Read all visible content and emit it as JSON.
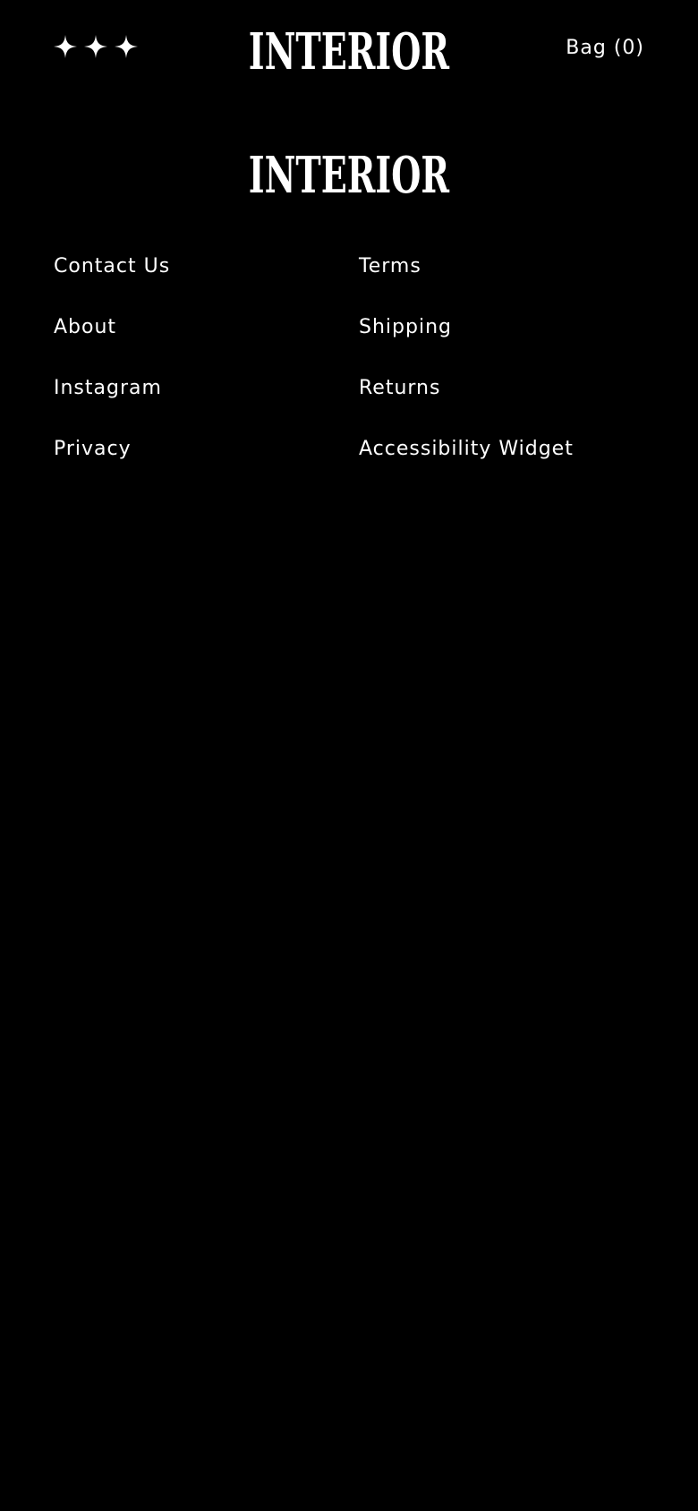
{
  "theme": {
    "background": "#000000",
    "foreground": "#ffffff"
  },
  "header": {
    "menu_icon": "sparkle-icon",
    "logo": "INTERIOR",
    "bag_label": "Bag (0)"
  },
  "footer": {
    "logo": "INTERIOR",
    "left_links": [
      {
        "label": "Contact Us"
      },
      {
        "label": "About"
      },
      {
        "label": "Instagram"
      },
      {
        "label": "Privacy"
      }
    ],
    "right_links": [
      {
        "label": "Terms"
      },
      {
        "label": "Shipping"
      },
      {
        "label": "Returns"
      },
      {
        "label": "Accessibility Widget"
      }
    ]
  }
}
